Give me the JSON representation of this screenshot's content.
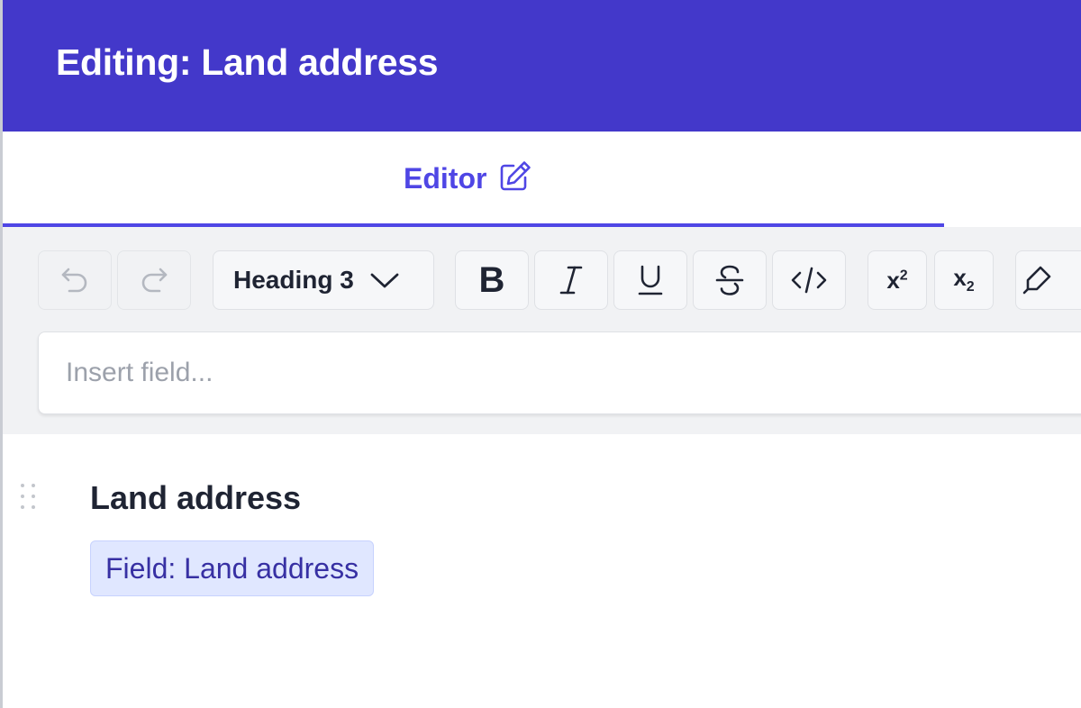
{
  "header": {
    "title": "Editing: Land address"
  },
  "tabs": [
    {
      "label": "Editor",
      "icon": "pencil-square-icon",
      "active": true
    }
  ],
  "toolbar": {
    "undo_icon": "undo-icon",
    "redo_icon": "redo-icon",
    "heading_select": {
      "selected": "Heading 3",
      "icon": "chevron-down-icon"
    },
    "bold_label": "B",
    "italic_label": "I",
    "underline_label": "U",
    "strike_label": "S",
    "code_label": "</>",
    "superscript": {
      "base": "x",
      "script": "2"
    },
    "subscript": {
      "base": "x",
      "script": "2"
    },
    "highlighter_icon": "highlighter-icon"
  },
  "insert_field": {
    "placeholder": "Insert field...",
    "value": ""
  },
  "content": {
    "heading": "Land address",
    "field_chip": "Field: Land address"
  },
  "colors": {
    "header_bg": "#4338ca",
    "accent": "#4f46e5",
    "chip_bg": "#e0e7ff",
    "chip_text": "#3730a3",
    "toolbar_bg": "#f1f2f4"
  }
}
